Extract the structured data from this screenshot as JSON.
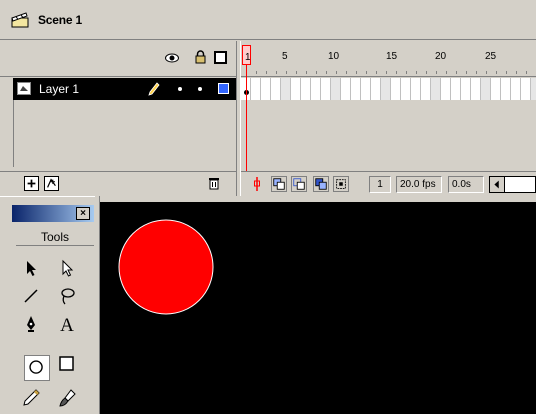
{
  "scene": {
    "label": "Scene 1"
  },
  "layers": [
    {
      "name": "Layer 1",
      "color": "#3366ff"
    }
  ],
  "ruler": {
    "labels": [
      "1",
      "5",
      "10",
      "15",
      "20",
      "25"
    ]
  },
  "status": {
    "current_frame": "1",
    "frame_rate": "20.0 fps",
    "elapsed": "0.0s"
  },
  "tools": {
    "title": "Tools"
  },
  "stage": {
    "background": "#000000",
    "circle_fill": "#ff0000",
    "circle_stroke": "#ffffff"
  }
}
